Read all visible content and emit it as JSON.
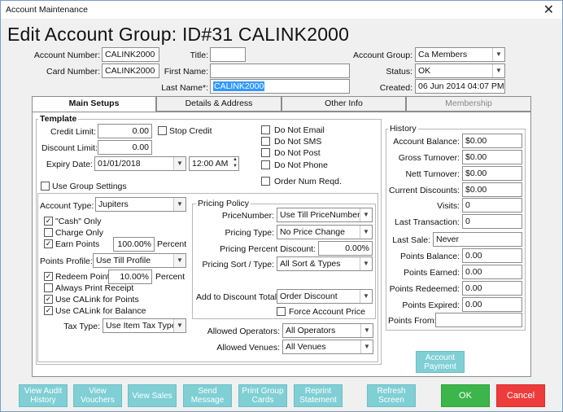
{
  "window": {
    "title": "Account Maintenance",
    "close": "✕"
  },
  "heading": "Edit Account Group: ID#31 CALINK2000",
  "top": {
    "account_number_label": "Account Number:",
    "account_number": "CALINK2000",
    "card_number_label": "Card Number:",
    "card_number": "CALINK2000",
    "title_label": "Title:",
    "title_value": "",
    "first_name_label": "First Name:",
    "first_name": "",
    "last_name_label": "Last Name*:",
    "last_name": "CALINK2000",
    "account_group_label": "Account Group:",
    "account_group": "Ca Members",
    "status_label": "Status:",
    "status": "OK",
    "created_label": "Created:",
    "created": "06 Jun 2014 04:07 PM"
  },
  "tabs": [
    {
      "label": "Main Setups"
    },
    {
      "label": "Details & Address"
    },
    {
      "label": "Other Info"
    },
    {
      "label": "Membership"
    }
  ],
  "template": {
    "title": "Template",
    "credit_limit_label": "Credit Limit:",
    "credit_limit": "0.00",
    "stop_credit": "Stop Credit",
    "discount_limit_label": "Discount Limit:",
    "discount_limit": "0.00",
    "expiry_date_label": "Expiry Date:",
    "expiry_date": "01/01/2018",
    "expiry_time": "12:00 AM",
    "use_group_settings": "Use Group Settings",
    "do_not_email": "Do Not Email",
    "do_not_sms": "Do Not SMS",
    "do_not_post": "Do Not Post",
    "do_not_phone": "Do Not Phone",
    "order_num_reqd": "Order Num Reqd.",
    "account_type_label": "Account Type:",
    "account_type": "Jupiters",
    "cash_only": "\"Cash\" Only",
    "charge_only": "Charge Only",
    "earn_points": "Earn Points",
    "earn_percent": "100.00%",
    "percent_label": "Percent",
    "points_profile_label": "Points Profile:",
    "points_profile": "Use Till Profile",
    "redeem_points": "Redeem Points",
    "redeem_percent": "10.00%",
    "redeem_percent_label": "Percent",
    "always_print_receipt": "Always Print Receipt",
    "use_calink_points": "Use CALink for Points",
    "use_calink_balance": "Use CALink for Balance",
    "tax_type_label": "Tax Type:",
    "tax_type": "Use Item Tax Type"
  },
  "pricing": {
    "title": "Pricing Policy",
    "price_number_label": "PriceNumber:",
    "price_number": "Use Till PriceNumber",
    "pricing_type_label": "Pricing Type:",
    "pricing_type": "No Price Change",
    "percent_discount_label": "Pricing Percent Discount:",
    "percent_discount": "0.00%",
    "sort_type_label": "Pricing Sort / Type:",
    "sort_type": "All Sort & Types",
    "add_to_discount_label": "Add to Discount Total:",
    "add_to_discount": "Order Discount",
    "force_account_price": "Force Account Price"
  },
  "allowed": {
    "operators_label": "Allowed Operators:",
    "operators": "All Operators",
    "venues_label": "Allowed Venues:",
    "venues": "All Venues"
  },
  "history": {
    "title": "History",
    "account_balance_label": "Account Balance:",
    "account_balance": "$0.00",
    "gross_turnover_label": "Gross Turnover:",
    "gross_turnover": "$0.00",
    "nett_turnover_label": "Nett Turnover:",
    "nett_turnover": "$0.00",
    "current_discounts_label": "Current Discounts:",
    "current_discounts": "$0.00",
    "visits_label": "Visits:",
    "visits": "0",
    "last_transaction_label": "Last Transaction:",
    "last_transaction": "0",
    "last_sale_label": "Last Sale:",
    "last_sale": "Never",
    "points_balance_label": "Points Balance:",
    "points_balance": "0.00",
    "points_earned_label": "Points Earned:",
    "points_earned": "0.00",
    "points_redeemed_label": "Points Redeemed:",
    "points_redeemed": "0.00",
    "points_expired_label": "Points Expired:",
    "points_expired": "0.00",
    "points_from_label": "Points From:",
    "points_from": ""
  },
  "account_payment": {
    "line1": "Account",
    "line2": "Payment"
  },
  "buttons": {
    "view_audit_1": "View Audit",
    "view_audit_2": "History",
    "view_vouchers_1": "View",
    "view_vouchers_2": "Vouchers",
    "view_sales": "View Sales",
    "send_message_1": "Send",
    "send_message_2": "Message",
    "print_group_1": "Print Group",
    "print_group_2": "Cards",
    "reprint_1": "Reprint",
    "reprint_2": "Statement",
    "refresh_1": "Refresh",
    "refresh_2": "Screen",
    "ok": "OK",
    "cancel": "Cancel"
  },
  "colors": {
    "teal": "#7fcfd5",
    "ok": "#3cb54a",
    "cancel": "#ee3b3b",
    "selection": "#3399ff"
  }
}
